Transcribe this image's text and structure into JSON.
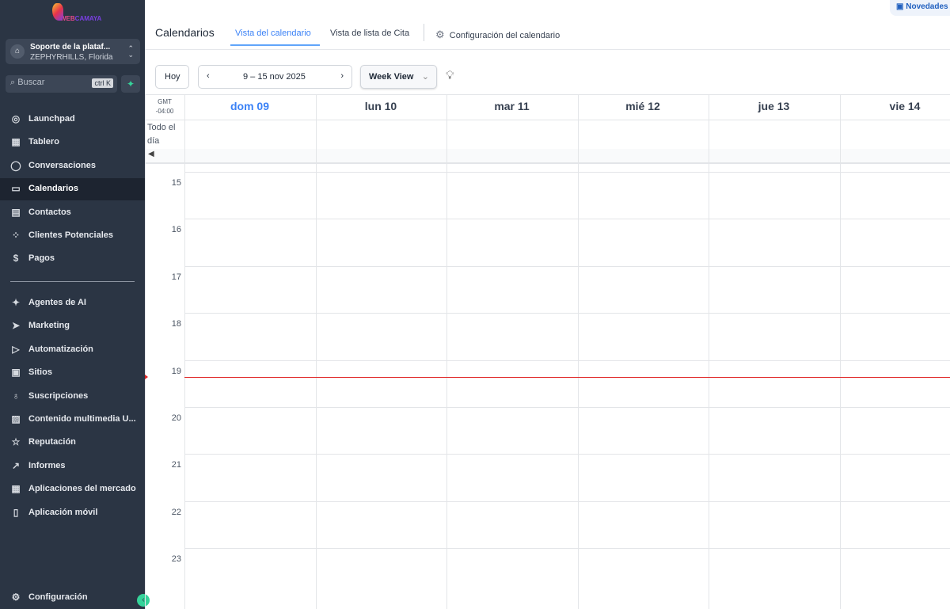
{
  "brand": {
    "logo_text": "WEBCAMAYA"
  },
  "account": {
    "name": "Soporte de la plataf...",
    "location": "ZEPHYRHILLS, Florida"
  },
  "search": {
    "placeholder": "Buscar",
    "shortcut": "ctrl K"
  },
  "nav": [
    {
      "label": "Launchpad",
      "icon": "rocket-icon",
      "glyph": "◎"
    },
    {
      "label": "Tablero",
      "icon": "dashboard-icon",
      "glyph": "▦"
    },
    {
      "label": "Conversaciones",
      "icon": "chat-icon",
      "glyph": "◯"
    },
    {
      "label": "Calendarios",
      "icon": "calendar-icon",
      "glyph": "▭"
    },
    {
      "label": "Contactos",
      "icon": "contacts-icon",
      "glyph": "▤"
    },
    {
      "label": "Clientes Potenciales",
      "icon": "leads-icon",
      "glyph": "⁘"
    },
    {
      "label": "Pagos",
      "icon": "payments-icon",
      "glyph": "$"
    },
    {
      "label": "Agentes de AI",
      "icon": "sparkles-icon",
      "glyph": "✦"
    },
    {
      "label": "Marketing",
      "icon": "send-icon",
      "glyph": "➤"
    },
    {
      "label": "Automatización",
      "icon": "automation-icon",
      "glyph": "▷"
    },
    {
      "label": "Sitios",
      "icon": "sites-icon",
      "glyph": "▣"
    },
    {
      "label": "Suscripciones",
      "icon": "badge-icon",
      "glyph": "♁"
    },
    {
      "label": "Contenido multimedia U...",
      "icon": "image-icon",
      "glyph": "▨"
    },
    {
      "label": "Reputación",
      "icon": "star-icon",
      "glyph": "☆"
    },
    {
      "label": "Informes",
      "icon": "chart-icon",
      "glyph": "↗"
    },
    {
      "label": "Aplicaciones del mercado",
      "icon": "apps-icon",
      "glyph": "▦"
    },
    {
      "label": "Aplicación móvil",
      "icon": "mobile-icon",
      "glyph": "▯"
    }
  ],
  "settings_label": "Configuración",
  "novedades": "Novedades",
  "header": {
    "title": "Calendarios",
    "tabs": [
      "Vista del calendario",
      "Vista de lista de Cita"
    ],
    "settings": "Configuración del calendario"
  },
  "toolbar": {
    "today": "Hoy",
    "range": "9 – 15 nov 2025",
    "view": "Week View"
  },
  "calendar": {
    "tz1": "GMT",
    "tz2": "-04:00",
    "allday": "Todo el día",
    "days": [
      "dom 09",
      "lun 10",
      "mar 11",
      "mié 12",
      "jue 13",
      "vie 14"
    ],
    "hours": [
      "15",
      "16",
      "17",
      "18",
      "19",
      "20",
      "21",
      "22",
      "23"
    ],
    "accent": "#3b82f6",
    "now_color": "#e02424"
  }
}
